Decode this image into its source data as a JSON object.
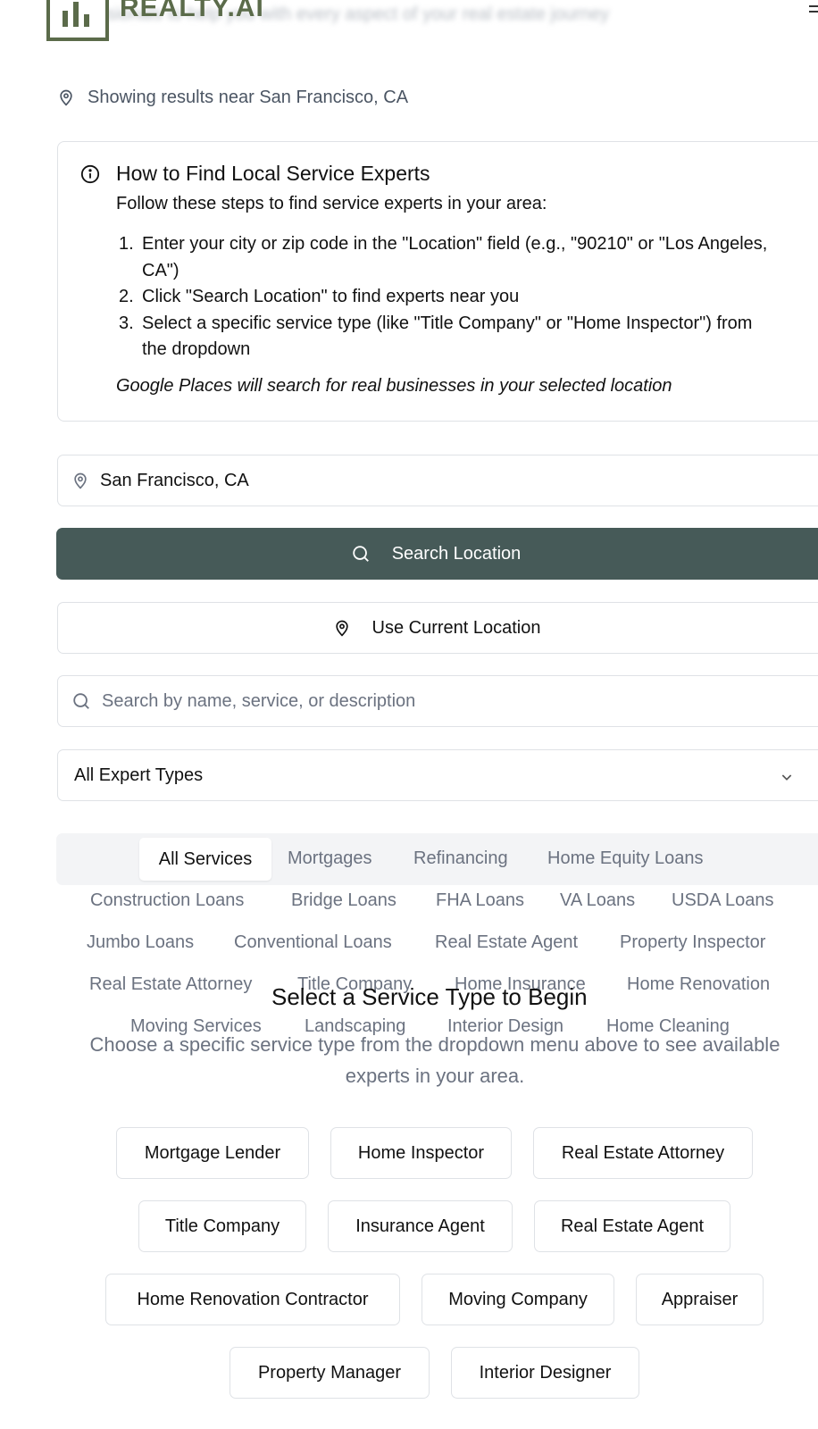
{
  "header": {
    "logo_text": "REALTY.AI",
    "subtitle_blurred": "professionals to help you with every aspect of your real estate journey"
  },
  "location_notice": "Showing results near San Francisco, CA",
  "info": {
    "title": "How to Find Local Service Experts",
    "intro": "Follow these steps to find service experts in your area:",
    "steps": [
      {
        "num": "1.",
        "text": "Enter your city or zip code in the \"Location\" field (e.g., \"90210\" or \"Los Angeles, CA\")"
      },
      {
        "num": "2.",
        "text": "Click \"Search Location\" to find experts near you"
      },
      {
        "num": "3.",
        "text": "Select a specific service type (like \"Title Company\" or \"Home Inspector\") from the dropdown"
      }
    ],
    "note": "Google Places will search for real businesses in your selected location"
  },
  "location_input": {
    "value": "San Francisco, CA"
  },
  "search_location_button": "Search Location",
  "current_location_button": "Use Current Location",
  "search_input": {
    "placeholder": "Search by name, service, or description"
  },
  "expert_type_select": "All Expert Types",
  "service_tabs": [
    "All Services",
    "Mortgages",
    "Refinancing",
    "Home Equity Loans",
    "Construction Loans",
    "Bridge Loans",
    "FHA Loans",
    "VA Loans",
    "USDA Loans",
    "Jumbo Loans",
    "Conventional Loans",
    "Real Estate Agent",
    "Property Inspector",
    "Real Estate Attorney",
    "Title Company",
    "Home Insurance",
    "Home Renovation",
    "Moving Services",
    "Landscaping",
    "Interior Design",
    "Home Cleaning"
  ],
  "empty_state": {
    "title": "Select a Service Type to Begin",
    "description": "Choose a specific service type from the dropdown menu above to see available experts in your area."
  },
  "service_type_chips": [
    "Mortgage Lender",
    "Home Inspector",
    "Real Estate Attorney",
    "Title Company",
    "Insurance Agent",
    "Real Estate Agent",
    "Home Renovation Contractor",
    "Moving Company",
    "Appraiser",
    "Property Manager",
    "Interior Designer"
  ],
  "colors": {
    "brand_olive": "#5b6b4a",
    "primary_button": "#465a58",
    "border": "#dfe2e6",
    "muted_text": "#6b7280"
  }
}
